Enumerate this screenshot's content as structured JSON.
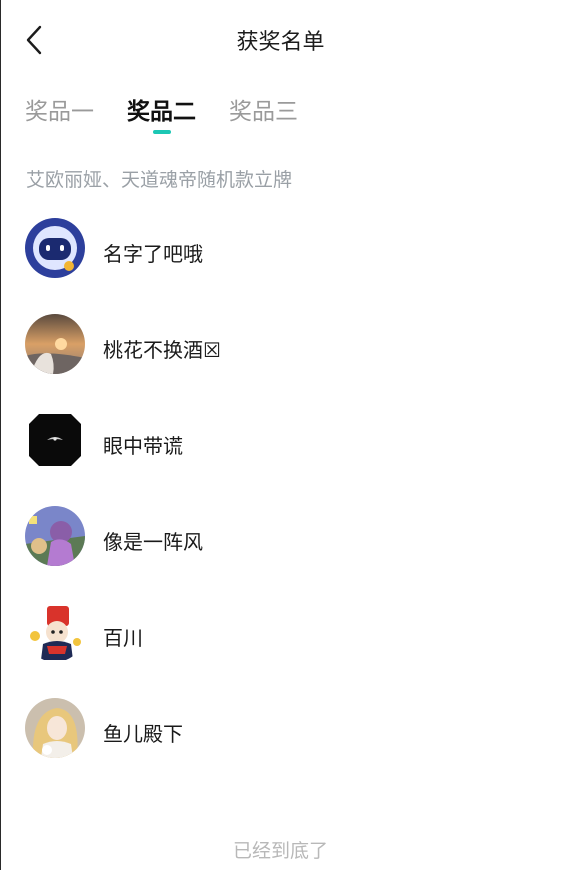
{
  "header": {
    "title": "获奖名单",
    "back_icon": "chevron-left-icon"
  },
  "tabs": [
    {
      "label": "奖品一",
      "active": false
    },
    {
      "label": "奖品二",
      "active": true
    },
    {
      "label": "奖品三",
      "active": false
    }
  ],
  "colors": {
    "accent": "#1cc7b4",
    "inactive_tab": "#9a9a9a",
    "muted_text": "#9aa0a6"
  },
  "prize": {
    "description": "艾欧丽娅、天道魂帝随机款立牌"
  },
  "winners": [
    {
      "name": "名字了吧哦",
      "avatar": "robot-avatar"
    },
    {
      "name": "桃花不换酒☒",
      "avatar": "sunset-avatar"
    },
    {
      "name": "眼中带谎",
      "avatar": "dark-logo-avatar"
    },
    {
      "name": "像是一阵风",
      "avatar": "game-character-avatar"
    },
    {
      "name": "百川",
      "avatar": "cartoon-avatar"
    },
    {
      "name": "鱼儿殿下",
      "avatar": "anime-girl-avatar"
    }
  ],
  "footer": {
    "end_text": "已经到底了"
  }
}
